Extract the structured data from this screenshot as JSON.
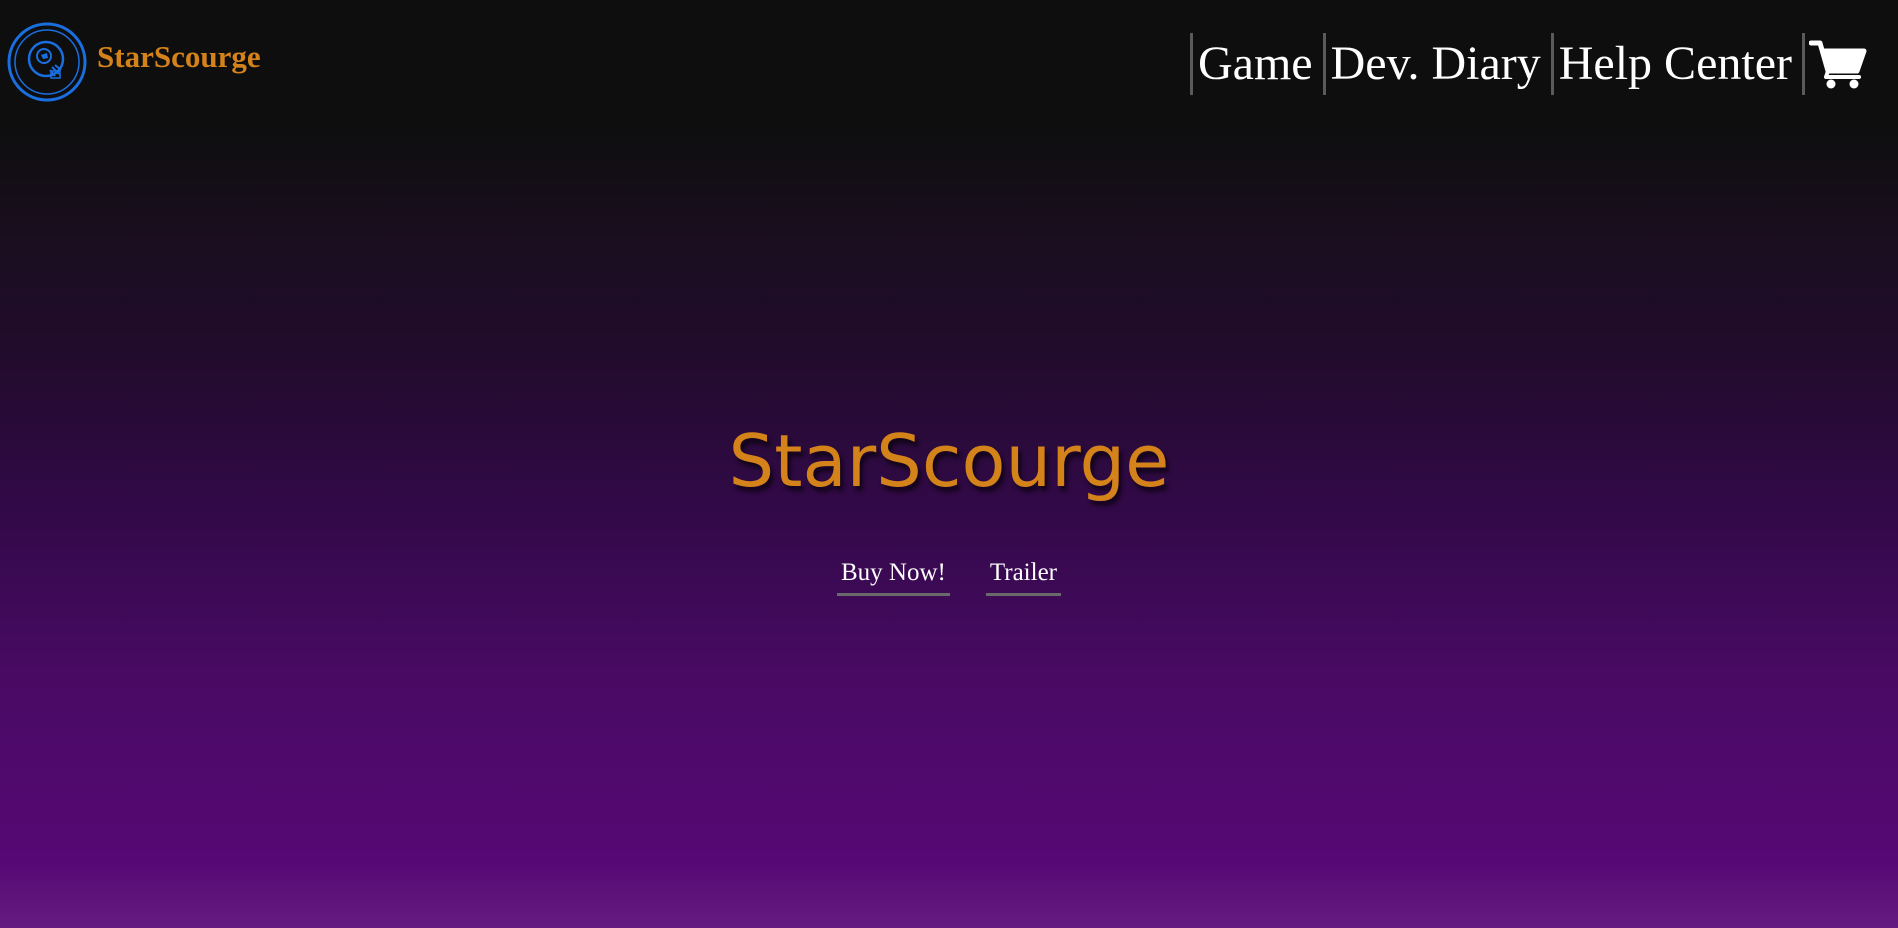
{
  "header": {
    "logo_icon": "crosshair-rocket-logo-icon",
    "brand": "StarScourge",
    "nav": [
      {
        "label": "Game"
      },
      {
        "label": "Dev. Diary"
      },
      {
        "label": "Help Center"
      }
    ],
    "cart_icon": "shopping-cart-icon"
  },
  "hero": {
    "title": "StarScourge",
    "buttons": [
      {
        "label": "Buy Now!"
      },
      {
        "label": "Trailer"
      }
    ]
  },
  "colors": {
    "brand_orange": "#d4821a",
    "logo_blue": "#1a6fe0",
    "nav_text": "#ffffff",
    "divider": "#5a5a5a",
    "bg_top": "#0e0e0f",
    "bg_bottom": "#641b80"
  }
}
